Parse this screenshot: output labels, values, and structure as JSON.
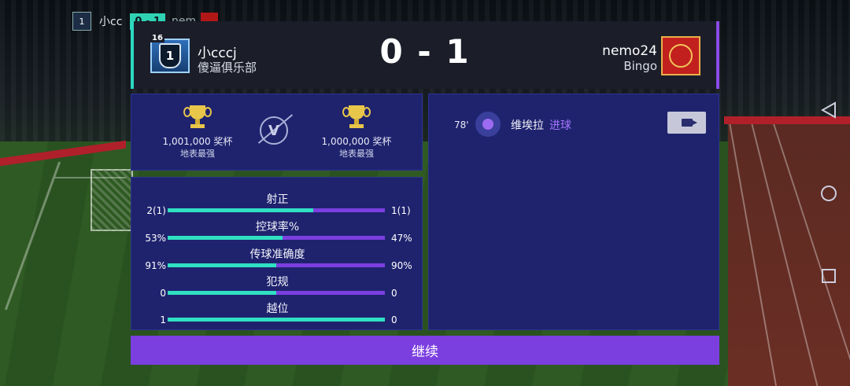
{
  "mini_scoreboard": {
    "home_level": "1",
    "home_name": "小cc",
    "score": "0 - 1",
    "away_name": "nem"
  },
  "header": {
    "home": {
      "level": "16",
      "badge_number": "1",
      "name": "小cccj",
      "club": "傻逼俱乐部"
    },
    "score": "0 - 1",
    "away": {
      "name": "nemo24",
      "club": "Bingo"
    }
  },
  "trophies": {
    "home": {
      "count": "1,001,000 奖杯",
      "title": "地表最强"
    },
    "vs": "V",
    "away": {
      "count": "1,000,000 奖杯",
      "title": "地表最强"
    }
  },
  "stats": [
    {
      "label": "射正",
      "home": "2(1)",
      "away": "1(1)",
      "home_share": 0.67
    },
    {
      "label": "控球率%",
      "home": "53%",
      "away": "47%",
      "home_share": 0.53
    },
    {
      "label": "传球准确度",
      "home": "91%",
      "away": "90%",
      "home_share": 0.5
    },
    {
      "label": "犯规",
      "home": "0",
      "away": "0",
      "home_share": 0.5
    },
    {
      "label": "越位",
      "home": "1",
      "away": "0",
      "home_share": 1.0
    }
  ],
  "events": [
    {
      "minute": "78'",
      "player": "维埃拉",
      "type": "进球",
      "icon": "ball-icon"
    }
  ],
  "continue_label": "继续",
  "colors": {
    "home_accent": "#2fe0c2",
    "away_accent": "#7b3fe0",
    "panel": "#1f236e",
    "header": "#1b1d29"
  }
}
